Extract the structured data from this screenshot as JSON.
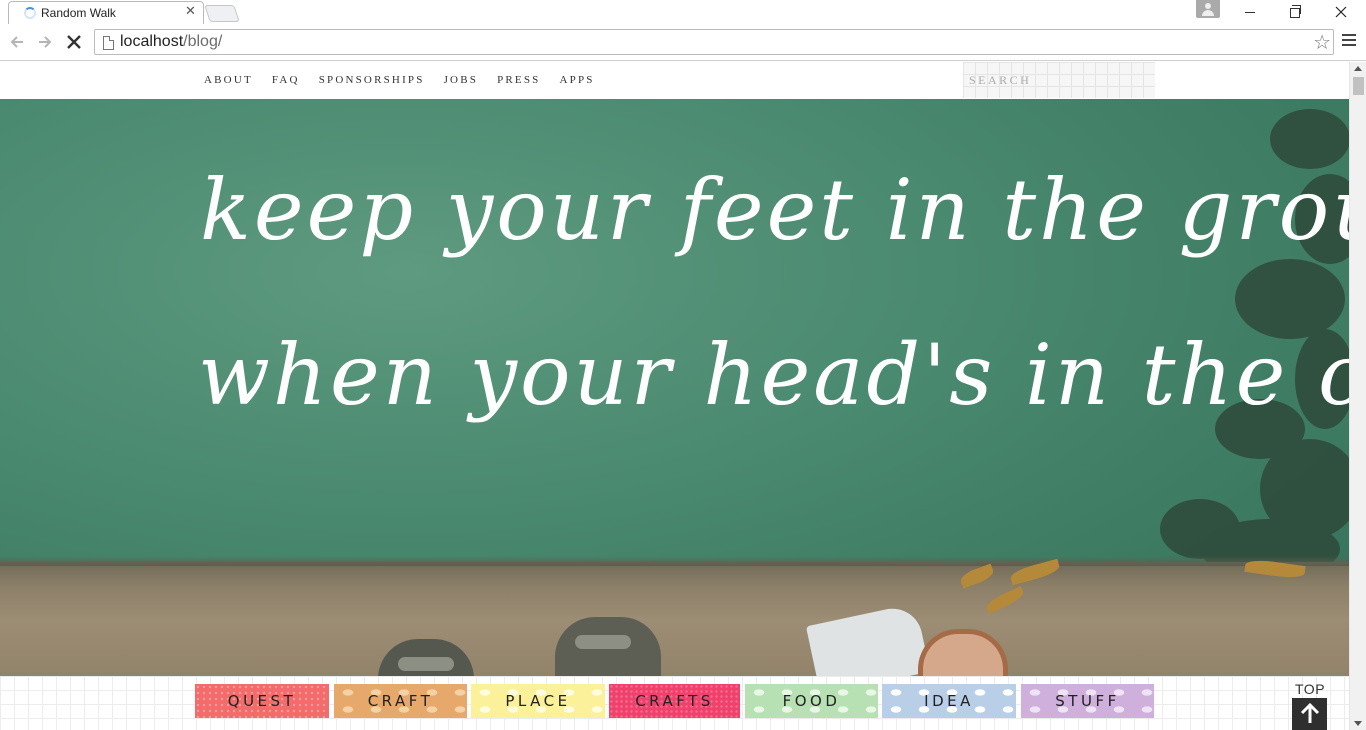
{
  "browser": {
    "tab_title": "Random Walk",
    "url_host": "localhost",
    "url_path": "/blog/"
  },
  "site": {
    "nav": [
      "ABOUT",
      "FAQ",
      "SPONSORSHIPS",
      "JOBS",
      "PRESS",
      "APPS"
    ],
    "search_placeholder": "SEARCH",
    "hero_quote_line1": "keep your feet in the ground",
    "hero_quote_line2": "when your head's in the clouds",
    "categories": [
      "QUEST",
      "CRAFT",
      "PLACE",
      "CRAFTS",
      "FOOD",
      "IDEA",
      "STUFF"
    ],
    "top_label": "TOP"
  },
  "colors": {
    "quest": "#f36b6b",
    "craft": "#e6a96b",
    "place": "#fbf19a",
    "crafts": "#f0416d",
    "food": "#b7e1b3",
    "idea": "#b8cfe7",
    "stuff": "#cfb0dc",
    "hero_water": "#4a8a70"
  }
}
